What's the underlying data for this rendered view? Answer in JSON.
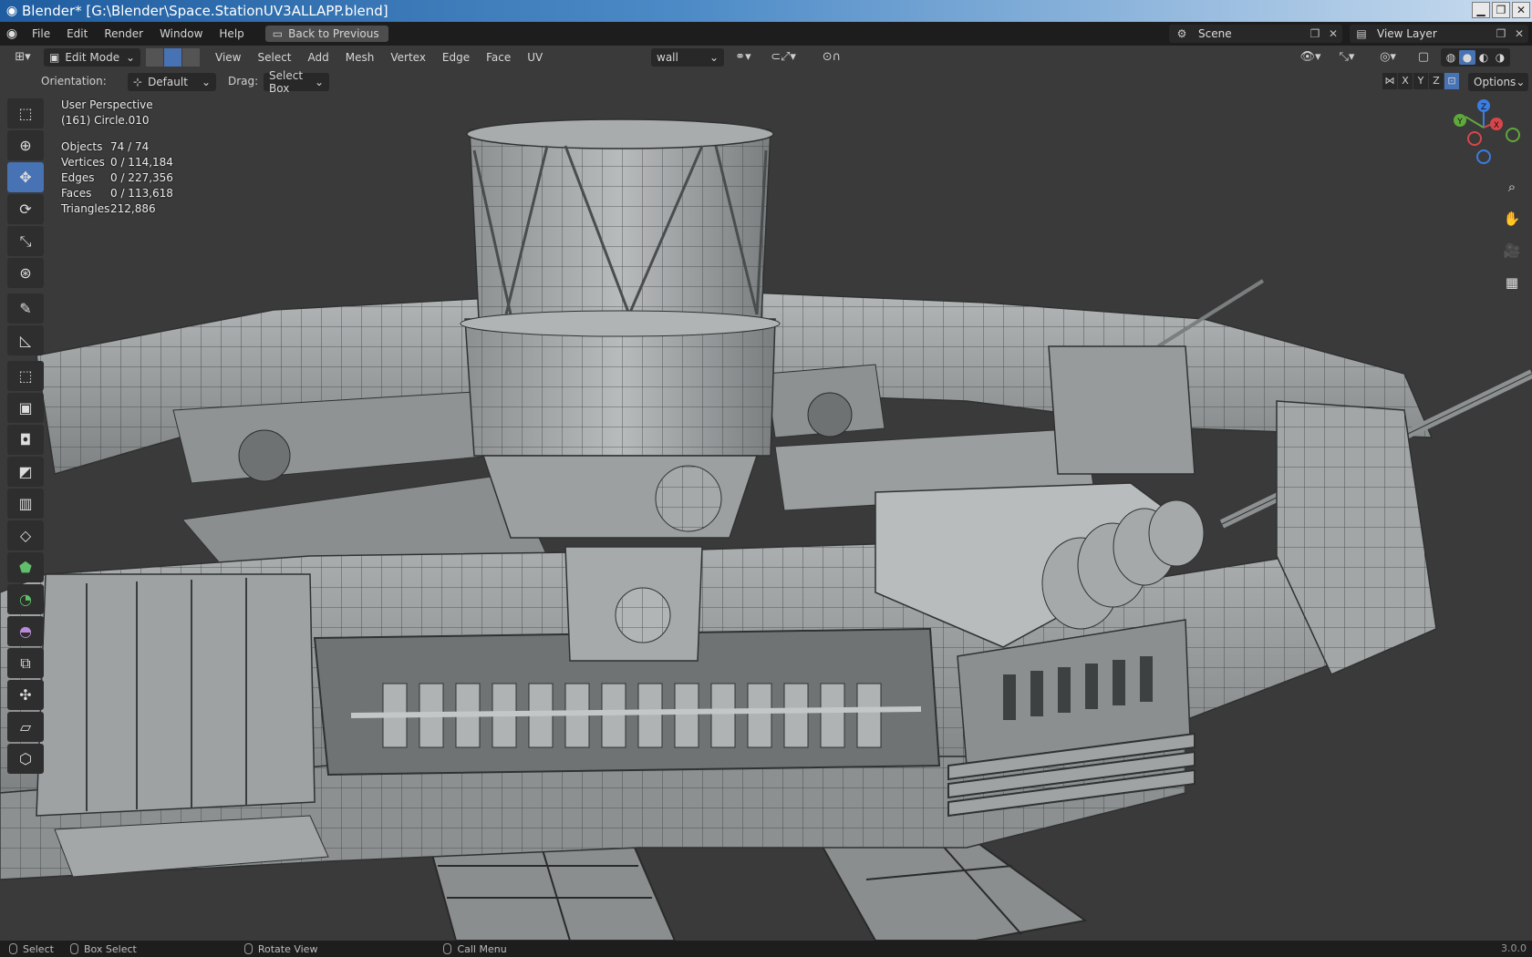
{
  "window": {
    "title": "Blender* [G:\\Blender\\Space.StationUV3ALLAPP.blend]",
    "buttons": [
      "minimize",
      "restore",
      "close"
    ]
  },
  "menubar": {
    "items": [
      "File",
      "Edit",
      "Render",
      "Window",
      "Help"
    ],
    "back_label": "Back to Previous",
    "scene_label": "Scene",
    "view_layer_label": "View Layer"
  },
  "viewport_header": {
    "mode": "Edit Mode",
    "menus": [
      "View",
      "Select",
      "Add",
      "Mesh",
      "Vertex",
      "Edge",
      "Face",
      "UV"
    ],
    "material": "wall",
    "orientation_label": "Orientation:",
    "orientation_value": "Default",
    "drag_label": "Drag:",
    "drag_value": "Select Box",
    "axes": [
      "X",
      "Y",
      "Z"
    ],
    "options_label": "Options"
  },
  "overlay": {
    "view_name": "User Perspective",
    "object_name": "(161) Circle.010",
    "stats": [
      {
        "label": "Objects",
        "value": "74 / 74"
      },
      {
        "label": "Vertices",
        "value": "0 / 114,184"
      },
      {
        "label": "Edges",
        "value": "0 / 227,356"
      },
      {
        "label": "Faces",
        "value": "0 / 113,618"
      },
      {
        "label": "Triangles",
        "value": "212,886"
      }
    ]
  },
  "gizmo": {
    "x": "X",
    "y": "Y",
    "z": "Z"
  },
  "statusbar": {
    "items": [
      "Select",
      "Box Select",
      "Rotate View",
      "Call Menu"
    ],
    "version": "3.0.0"
  },
  "colors": {
    "accent": "#4772b3",
    "viewport_bg": "#3a3a3a",
    "mesh": "#9ea2a3"
  }
}
